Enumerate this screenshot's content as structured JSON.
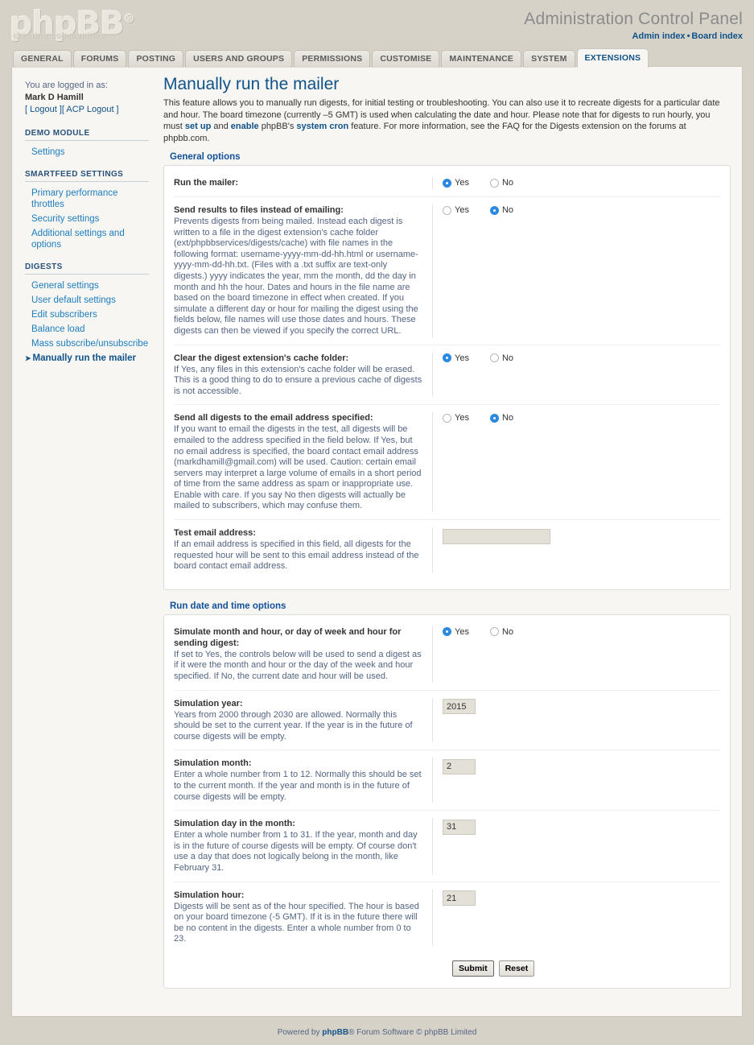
{
  "header": {
    "logo_text": "phpBB",
    "logo_reg": "®",
    "logo_tagline": "creating communities",
    "title": "Administration Control Panel",
    "link_admin_index": "Admin index",
    "link_separator": "•",
    "link_board_index": "Board index"
  },
  "tabs": [
    {
      "label": "GENERAL",
      "active": false
    },
    {
      "label": "FORUMS",
      "active": false
    },
    {
      "label": "POSTING",
      "active": false
    },
    {
      "label": "USERS AND GROUPS",
      "active": false
    },
    {
      "label": "PERMISSIONS",
      "active": false
    },
    {
      "label": "CUSTOMISE",
      "active": false
    },
    {
      "label": "MAINTENANCE",
      "active": false
    },
    {
      "label": "SYSTEM",
      "active": false
    },
    {
      "label": "EXTENSIONS",
      "active": true
    }
  ],
  "sidebar": {
    "logged_in_label": "You are logged in as:",
    "username": "Mark D Hamill",
    "logout_links": "[ Logout ][ ACP Logout ]",
    "groups": [
      {
        "heading": "DEMO MODULE",
        "items": [
          {
            "label": "Settings",
            "active": false
          }
        ]
      },
      {
        "heading": "SMARTFEED SETTINGS",
        "items": [
          {
            "label": "Primary performance throttles",
            "active": false
          },
          {
            "label": "Security settings",
            "active": false
          },
          {
            "label": "Additional settings and options",
            "active": false
          }
        ]
      },
      {
        "heading": "DIGESTS",
        "items": [
          {
            "label": "General settings",
            "active": false
          },
          {
            "label": "User default settings",
            "active": false
          },
          {
            "label": "Edit subscribers",
            "active": false
          },
          {
            "label": "Balance load",
            "active": false
          },
          {
            "label": "Mass subscribe/unsubscribe",
            "active": false
          },
          {
            "label": "Manually run the mailer",
            "active": true
          }
        ]
      }
    ]
  },
  "main": {
    "page_title": "Manually run the mailer",
    "page_desc_1": "This feature allows you to manually run digests, for initial testing or troubleshooting. You can also use it to recreate digests for a particular date and hour. The board timezone (currently –5 GMT) is used when calculating the date and hour. Please note that for digests to run hourly, you must ",
    "page_desc_link_1": "set up",
    "page_desc_2": " and ",
    "page_desc_link_2": "enable",
    "page_desc_3": " phpBB's ",
    "page_desc_bold_1": "system cron",
    "page_desc_4": " feature. For more information, see the FAQ for the Digests extension on the forums at phpbb.com.",
    "panels": [
      {
        "legend": "General options",
        "rows": [
          {
            "title": "Run the mailer:",
            "desc": "",
            "control": "radio",
            "options": [
              "Yes",
              "No"
            ],
            "selected": "Yes"
          },
          {
            "title": "Send results to files instead of emailing:",
            "desc": "Prevents digests from being mailed. Instead each digest is written to a file in the digest extension's cache folder (ext/phpbbservices/digests/cache) with file names in the following format: username-yyyy-mm-dd-hh.html or username-yyyy-mm-dd-hh.txt. (Files with a .txt suffix are text-only digests.) yyyy indicates the year, mm the month, dd the day in month and hh the hour. Dates and hours in the file name are based on the board timezone in effect when created. If you simulate a different day or hour for mailing the digest using the fields below, file names will use those dates and hours. These digests can then be viewed if you specify the correct URL.",
            "control": "radio",
            "options": [
              "Yes",
              "No"
            ],
            "selected": "No"
          },
          {
            "title": "Clear the digest extension's cache folder:",
            "desc": "If Yes, any files in this extension's cache folder will be erased. This is a good thing to do to ensure a previous cache of digests is not accessible.",
            "control": "radio",
            "options": [
              "Yes",
              "No"
            ],
            "selected": "Yes"
          },
          {
            "title": "Send all digests to the email address specified:",
            "desc": "If you want to email the digests in the test, all digests will be emailed to the address specified in the field below. If Yes, but no email address is specified, the board contact email address (markdhamill@gmail.com) will be used. Caution: certain email servers may interpret a large volume of emails in a short period of time from the same address as spam or inappropriate use. Enable with care. If you say No then digests will actually be mailed to subscribers, which may confuse them.",
            "control": "radio",
            "options": [
              "Yes",
              "No"
            ],
            "selected": "No"
          },
          {
            "title": "Test email address:",
            "desc": "If an email address is specified in this field, all digests for the requested hour will be sent to this email address instead of the board contact email address.",
            "control": "text-wide",
            "value": "",
            "placeholder": ""
          }
        ]
      },
      {
        "legend": "Run date and time options",
        "rows": [
          {
            "title": "Simulate month and hour, or day of week and hour for sending digest:",
            "desc": "If set to Yes, the controls below will be used to send a digest as if it were the month and hour or the day of the week and hour specified. If No, the current date and hour will be used.",
            "control": "radio",
            "options": [
              "Yes",
              "No"
            ],
            "selected": "Yes"
          },
          {
            "title": "Simulation year:",
            "desc": "Years from 2000 through 2030 are allowed. Normally this should be set to the current year. If the year is in the future of course digests will be empty.",
            "control": "text-num",
            "value": "2015"
          },
          {
            "title": "Simulation month:",
            "desc": "Enter a whole number from 1 to 12. Normally this should be set to the current month. If the year and month is in the future of course digests will be empty.",
            "control": "text-num",
            "value": "2"
          },
          {
            "title": "Simulation day in the month:",
            "desc": "Enter a whole number from 1 to 31. If the year, month and day is in the future of course digests will be empty. Of course don't use a day that does not logically belong in the month, like February 31.",
            "control": "text-num",
            "value": "31"
          },
          {
            "title": "Simulation hour:",
            "desc": "Digests will be sent as of the hour specified. The hour is based on your board timezone (-5 GMT). If it is in the future there will be no content in the digests. Enter a whole number from 0 to 23.",
            "control": "text-num",
            "value": "21"
          }
        ],
        "buttons": {
          "submit": "Submit",
          "reset": "Reset"
        }
      }
    ]
  },
  "footer": {
    "prefix": "Powered by ",
    "brand": "phpBB",
    "suffix": "® Forum Software © phpBB Limited"
  },
  "colors": {
    "accent_blue": "#105289",
    "link_blue": "#1d7dbc",
    "radio_on": "#2b8ae0",
    "page_bg": "#d6d2c8",
    "frame_bg": "#f7f6f3",
    "panel_bg": "#ffffff",
    "input_bg": "#e3e0d8"
  }
}
